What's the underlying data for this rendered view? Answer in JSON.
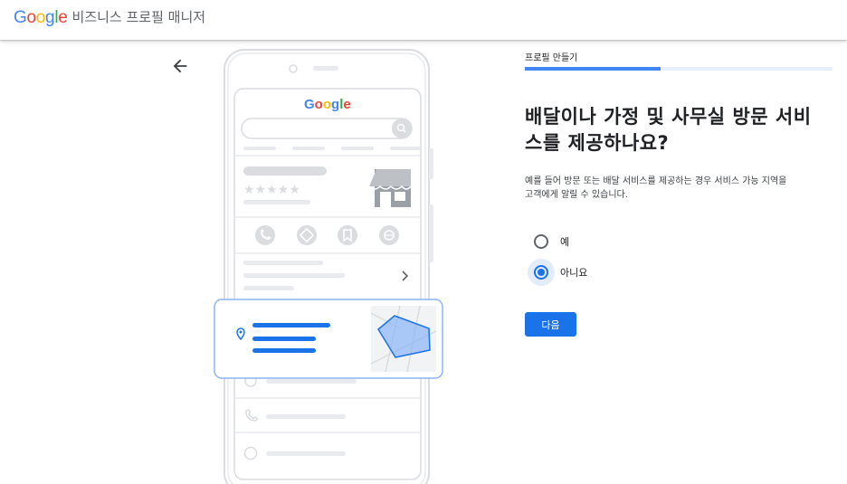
{
  "header": {
    "logo_letters": [
      {
        "char": "G",
        "color": "#4285F4"
      },
      {
        "char": "o",
        "color": "#EA4335"
      },
      {
        "char": "o",
        "color": "#FBBC05"
      },
      {
        "char": "g",
        "color": "#4285F4"
      },
      {
        "char": "l",
        "color": "#34A853"
      },
      {
        "char": "e",
        "color": "#EA4335"
      }
    ],
    "product_name": "비즈니스 프로필 매니저"
  },
  "back_icon": "arrow-back-icon",
  "illustration": {
    "logo_text": "Google",
    "rating_stars": "★★★★★"
  },
  "panel": {
    "step_label": "프로필 만들기",
    "progress_fraction": 0.44,
    "question": "배달이나 가정 및 사무실 방문 서비스를 제공하나요?",
    "question_line1": "배달이나 가정 및 사무실 방문 서비",
    "question_line2": "스를 제공하나요?",
    "description_line1": "예를 들어 방문 또는 배달 서비스를 제공하는 경우 서비스 가능 지역을",
    "description_line2": "고객에게 알릴 수 있습니다.",
    "options": [
      {
        "label": "예",
        "selected": false
      },
      {
        "label": "아니요",
        "selected": true
      }
    ],
    "next_label": "다음"
  },
  "colors": {
    "accent": "#1a73e8",
    "progress_track": "#e8f0fe",
    "progress_fill": "#4285f4"
  }
}
